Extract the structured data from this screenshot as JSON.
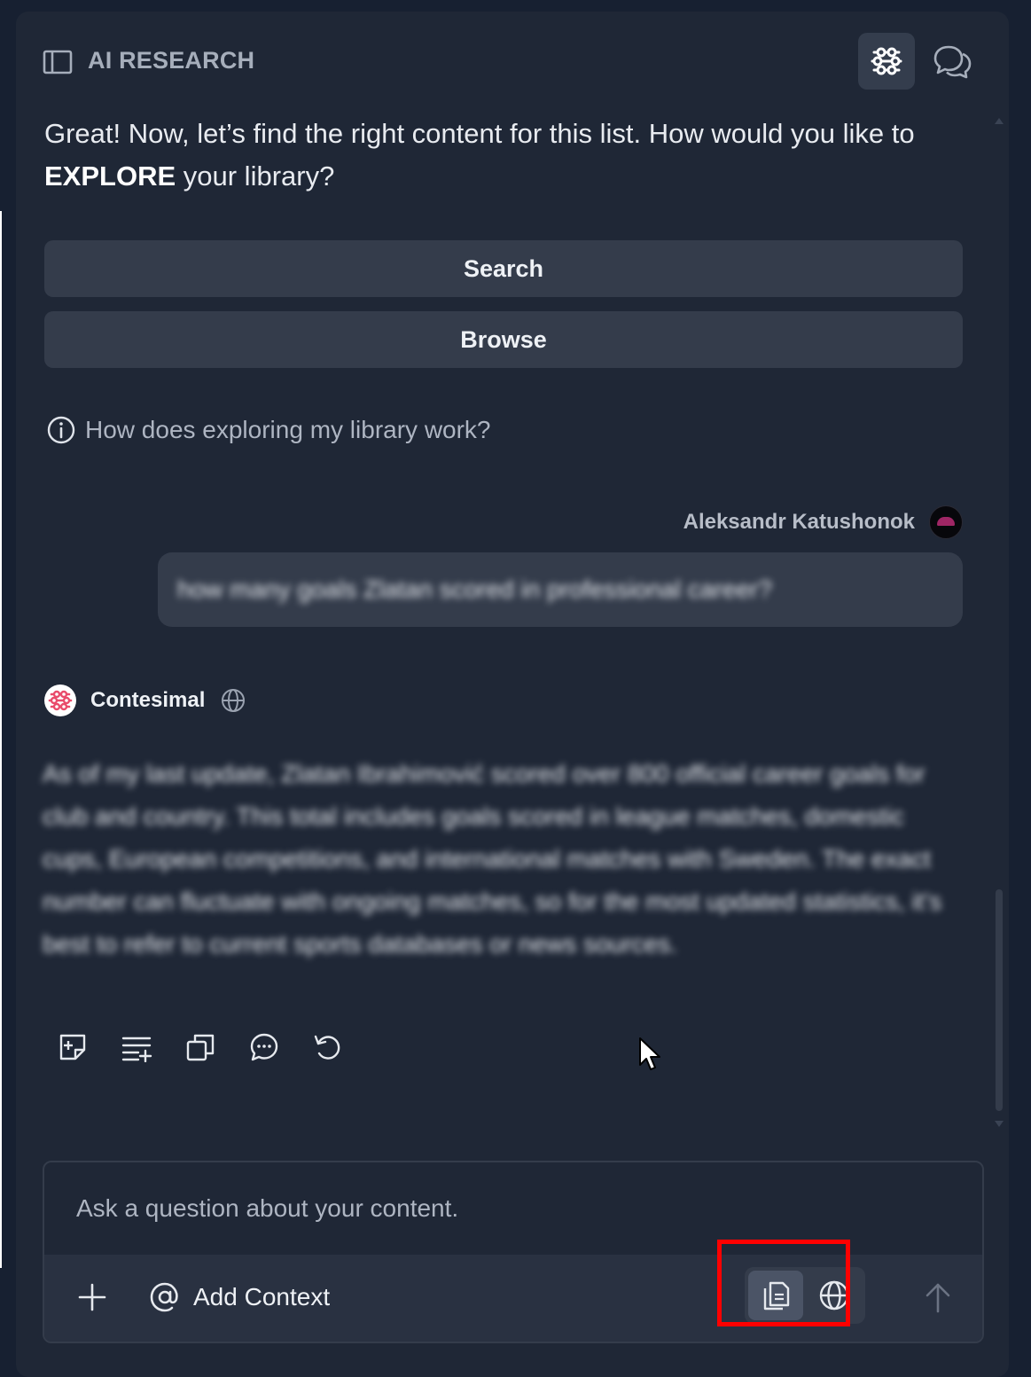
{
  "header": {
    "title": "AI RESEARCH"
  },
  "conversation": {
    "intro_before": "Great! Now, let’s find the right content for this list. How would you like to ",
    "intro_bold": "EXPLORE",
    "intro_after": " your library?",
    "options": [
      {
        "label": "Search"
      },
      {
        "label": "Browse"
      }
    ],
    "help_link": "How does exploring my library work?",
    "user": {
      "name": "Aleksandr Katushonok",
      "message": "how many goals Zlatan scored in professional career?"
    },
    "assistant": {
      "name": "Contesimal",
      "answer": "As of my last update, Zlatan Ibrahimović scored over 800 official career goals for club and country. This total includes goals scored in league matches, domestic cups, European competitions, and international matches with Sweden. The exact number can fluctuate with ongoing matches, so for the most updated statistics, it’s best to refer to current sports databases or news sources."
    }
  },
  "composer": {
    "placeholder": "Ask a question about your content.",
    "add_context_label": "Add Context"
  },
  "colors": {
    "accent": "#e94b6b",
    "highlight": "#ff0000",
    "panel_bg": "#1f2736",
    "button_bg": "#343c4b"
  },
  "icons": [
    "sidebar-toggle-icon",
    "sliders-icon",
    "chat-bubbles-icon",
    "info-icon",
    "globe-icon",
    "add-note-icon",
    "add-to-list-icon",
    "copy-icon",
    "comment-icon",
    "regenerate-icon",
    "plus-icon",
    "at-icon",
    "document-icon",
    "arrow-up-icon"
  ]
}
